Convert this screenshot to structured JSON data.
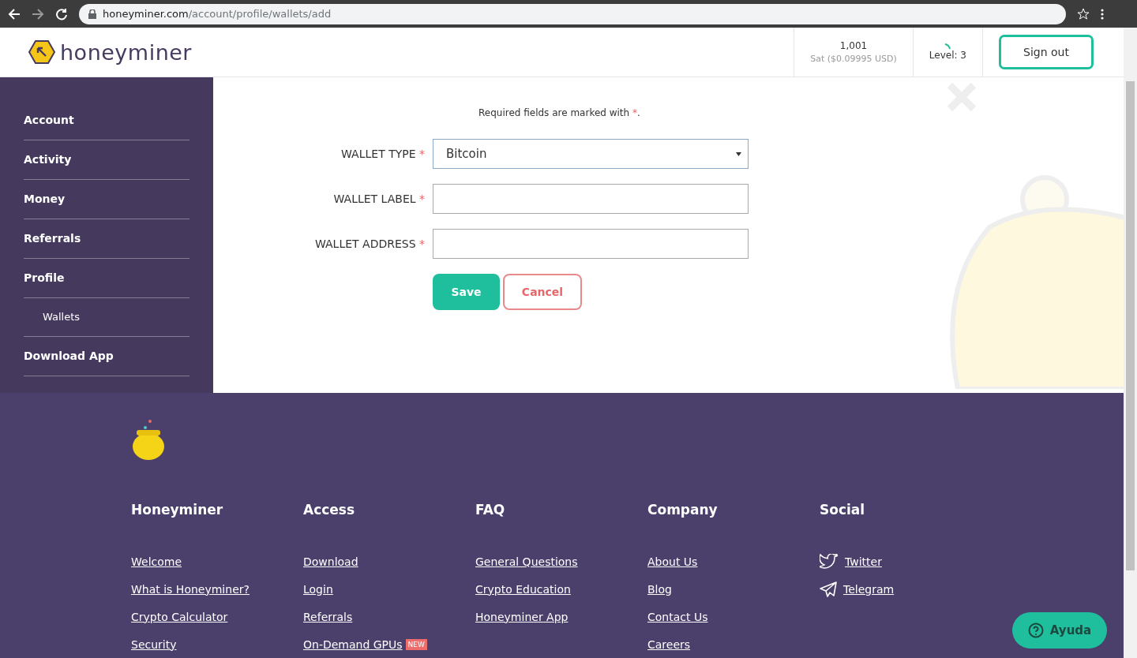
{
  "browser": {
    "url_host": "honeyminer.com",
    "url_path": "/account/profile/wallets/add"
  },
  "header": {
    "logo_text": "honeyminer",
    "balance": "1,001",
    "balance_sub": "Sat ($0.09995 USD)",
    "level": "Level: 3",
    "sign_out": "Sign out"
  },
  "sidebar": {
    "items": [
      {
        "label": "Account"
      },
      {
        "label": "Activity"
      },
      {
        "label": "Money"
      },
      {
        "label": "Referrals"
      },
      {
        "label": "Profile",
        "children": [
          {
            "label": "Wallets"
          }
        ]
      },
      {
        "label": "Download App"
      }
    ]
  },
  "form": {
    "note": "Required fields are marked with",
    "note_mark": "*",
    "note_end": ".",
    "fields": [
      {
        "label": "WALLET TYPE",
        "required_mark": "*",
        "kind": "select",
        "value": "Bitcoin"
      },
      {
        "label": "WALLET LABEL",
        "required_mark": "*",
        "kind": "text"
      },
      {
        "label": "WALLET ADDRESS",
        "required_mark": "*",
        "kind": "text"
      }
    ],
    "save": "Save",
    "cancel": "Cancel"
  },
  "footer": {
    "columns": [
      {
        "title": "Honeyminer",
        "links": [
          {
            "label": "Welcome"
          },
          {
            "label": "What is Honeyminer?"
          },
          {
            "label": "Crypto Calculator"
          },
          {
            "label": "Security"
          }
        ]
      },
      {
        "title": "Access",
        "links": [
          {
            "label": "Download"
          },
          {
            "label": "Login"
          },
          {
            "label": "Referrals"
          },
          {
            "label": "On-Demand GPUs",
            "badge": "NEW"
          }
        ]
      },
      {
        "title": "FAQ",
        "links": [
          {
            "label": "General Questions"
          },
          {
            "label": "Crypto Education"
          },
          {
            "label": "Honeyminer App"
          }
        ]
      },
      {
        "title": "Company",
        "links": [
          {
            "label": "About Us"
          },
          {
            "label": "Blog"
          },
          {
            "label": "Contact Us"
          },
          {
            "label": "Careers"
          }
        ]
      },
      {
        "title": "Social",
        "links": [
          {
            "label": "Twitter",
            "kind": "bird"
          },
          {
            "label": "Telegram",
            "kind": "plane"
          }
        ]
      }
    ]
  },
  "help": {
    "label": "Ayuda"
  }
}
